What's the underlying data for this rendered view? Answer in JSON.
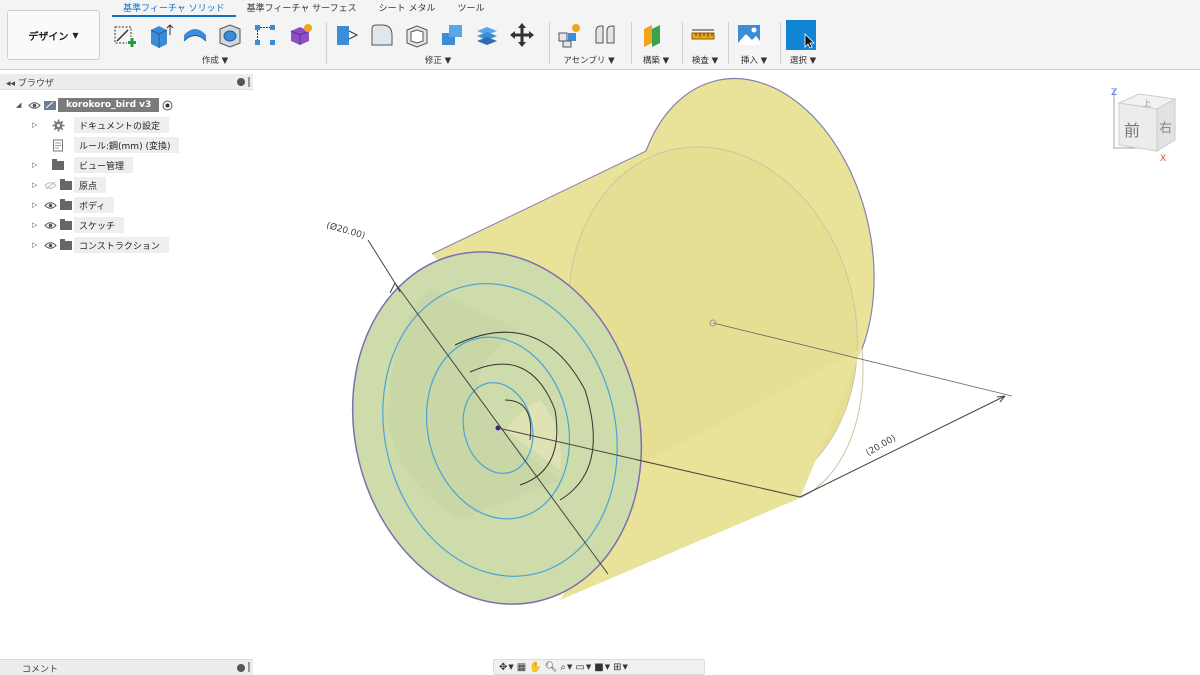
{
  "workspace": {
    "label": "デザイン"
  },
  "tabs": [
    {
      "label": "基準フィーチャ ソリッド",
      "active": true
    },
    {
      "label": "基準フィーチャ サーフェス",
      "active": false
    },
    {
      "label": "シート メタル",
      "active": false
    },
    {
      "label": "ツール",
      "active": false
    }
  ],
  "groups": {
    "create": "作成",
    "modify": "修正",
    "assemble": "アセンブリ",
    "construct": "構築",
    "inspect": "検査",
    "insert": "挿入",
    "select": "選択"
  },
  "browser": {
    "title": "ブラウザ",
    "root": "korokoro_bird v3",
    "items": [
      {
        "label": "ドキュメントの設定",
        "icon": "gear-icon"
      },
      {
        "label": "ルール:鋼(mm) (変換)",
        "icon": "units-icon"
      },
      {
        "label": "ビュー管理",
        "icon": "folder-icon"
      },
      {
        "label": "原点",
        "icon": "folder-icon"
      },
      {
        "label": "ボディ",
        "icon": "folder-icon"
      },
      {
        "label": "スケッチ",
        "icon": "folder-icon"
      },
      {
        "label": "コンストラクション",
        "icon": "folder-icon"
      }
    ]
  },
  "comments": {
    "title": "コメント"
  },
  "viewcube": {
    "front": "前",
    "right": "右",
    "top": "上",
    "axis_z": "Z",
    "axis_x": "X"
  },
  "dimensions": {
    "diameter": "(Ø20.00)",
    "length": "(20.00)"
  },
  "colors": {
    "accent": "#0a74c9",
    "cylinder": "#e9e39a",
    "face": "#cddcaa"
  }
}
